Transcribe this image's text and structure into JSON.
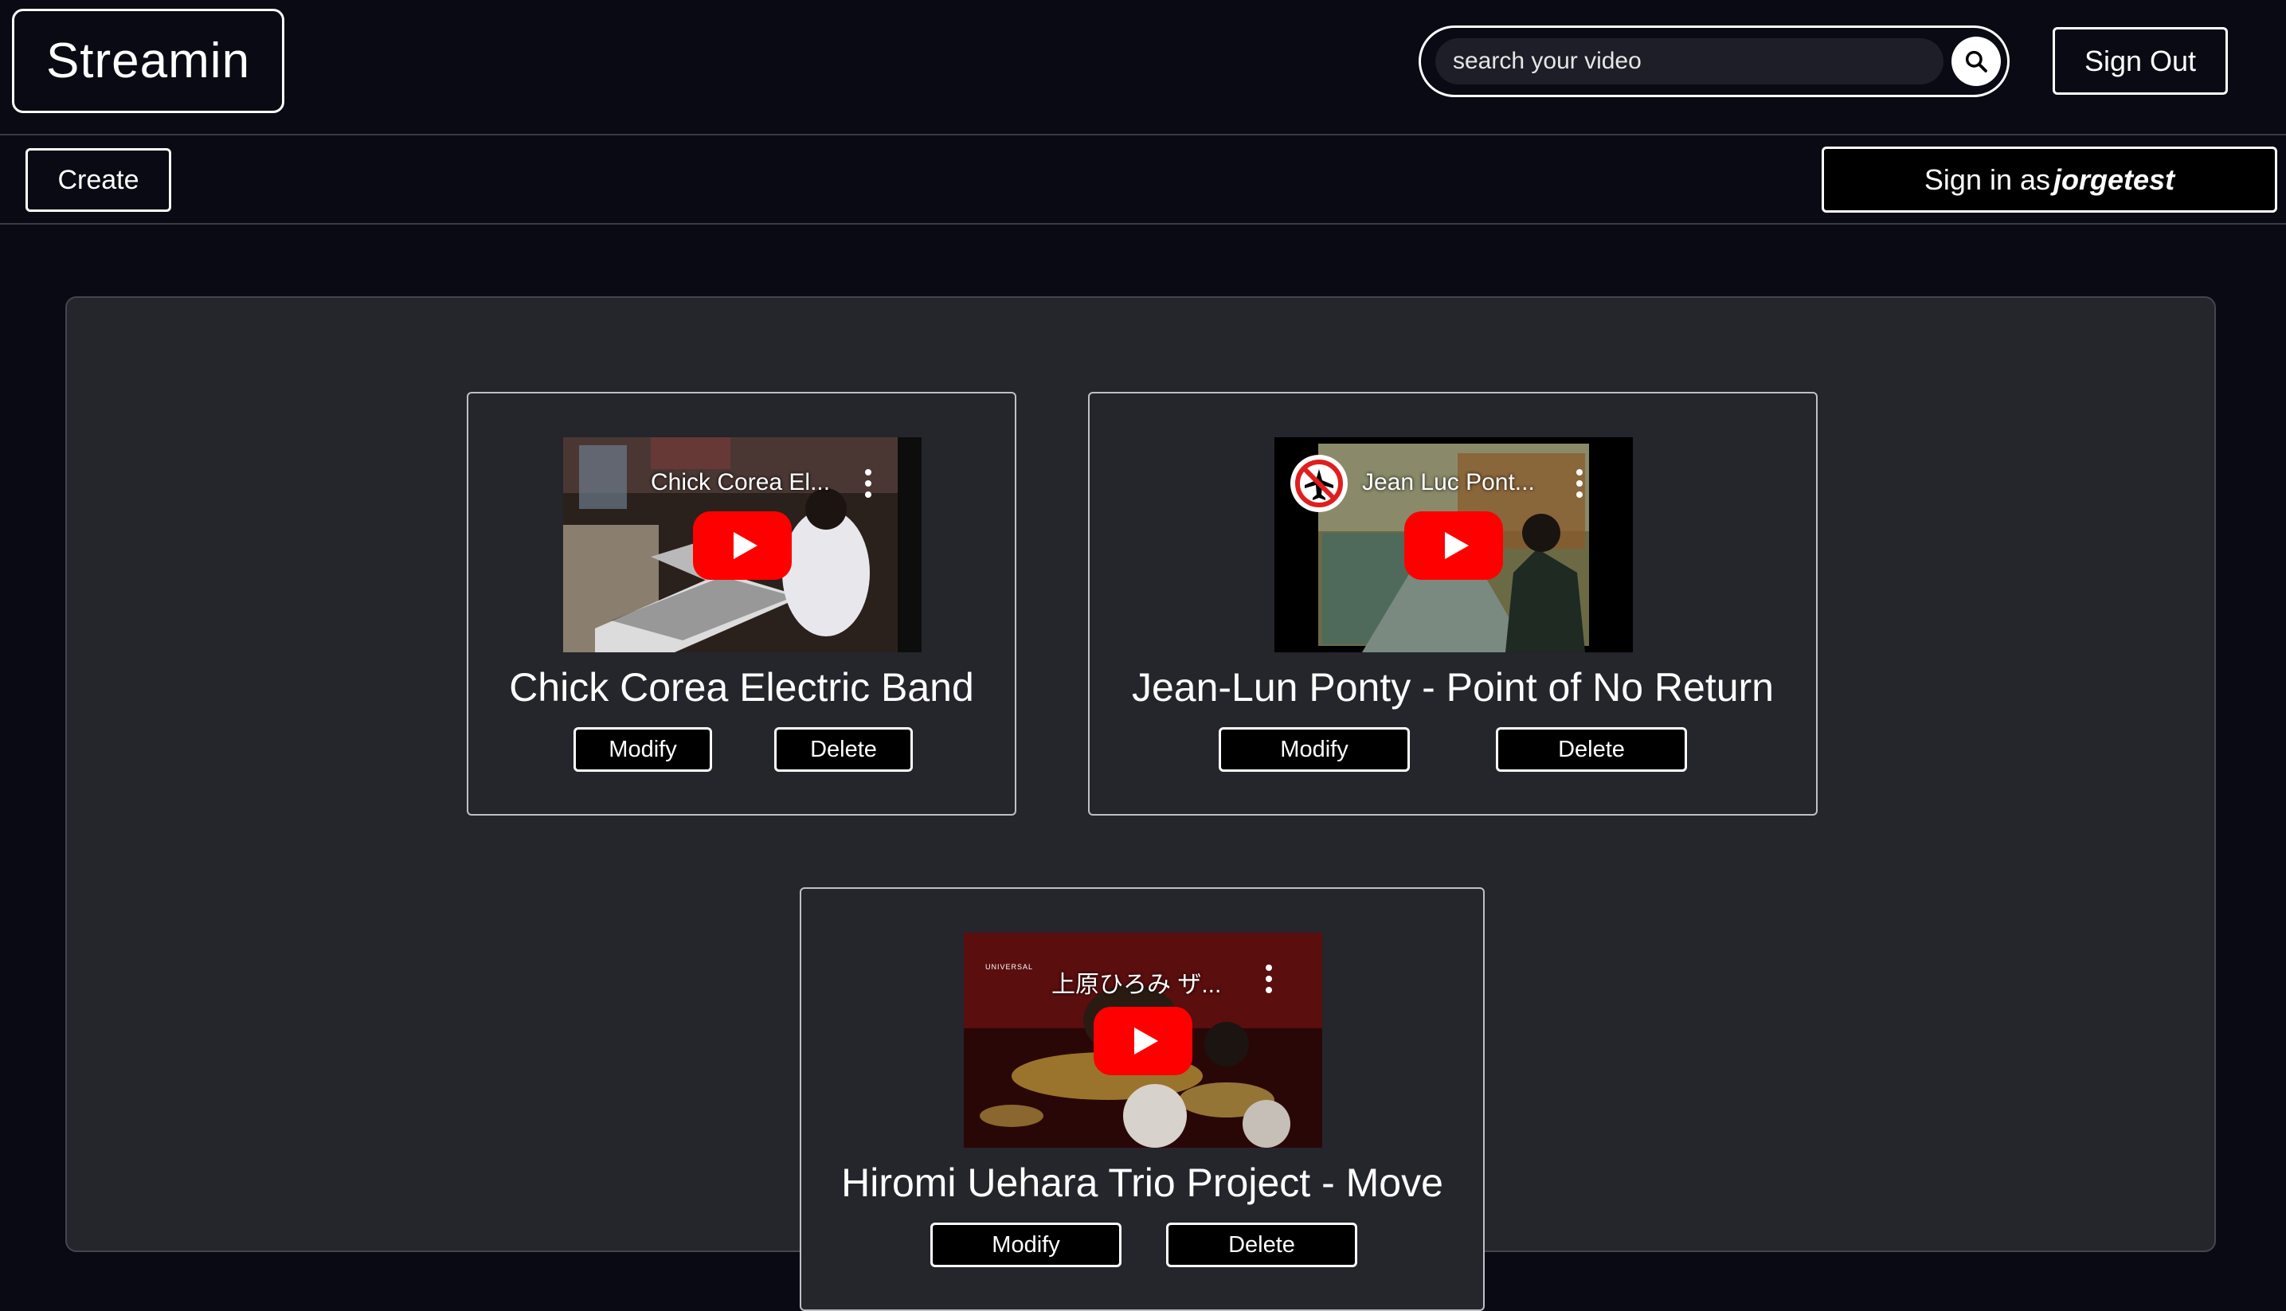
{
  "header": {
    "brand": "Streamin",
    "search_placeholder": "search your video",
    "search_value": "",
    "signout_label": "Sign Out"
  },
  "subbar": {
    "create_label": "Create",
    "signed_in_prefix": "Sign in as",
    "username": "jorgetest"
  },
  "videos": [
    {
      "title": "Chick Corea Electric Band",
      "thumb_title": "Chick Corea El...",
      "modify_label": "Modify",
      "delete_label": "Delete"
    },
    {
      "title": "Jean-Lun Ponty - Point of No Return",
      "thumb_title": "Jean Luc Pont...",
      "modify_label": "Modify",
      "delete_label": "Delete"
    },
    {
      "title": "Hiromi Uehara Trio Project - Move",
      "thumb_title": "上原ひろみ ザ...",
      "channel_logo_text": "UNIVERSAL",
      "modify_label": "Modify",
      "delete_label": "Delete"
    }
  ],
  "colors": {
    "background": "#0a0a14",
    "panel": "#25252c",
    "youtube_red": "#ff0000"
  },
  "icons": {
    "search": "search-icon",
    "play": "play-icon",
    "more": "more-vertical-icon",
    "channel": "no-flight-icon"
  }
}
